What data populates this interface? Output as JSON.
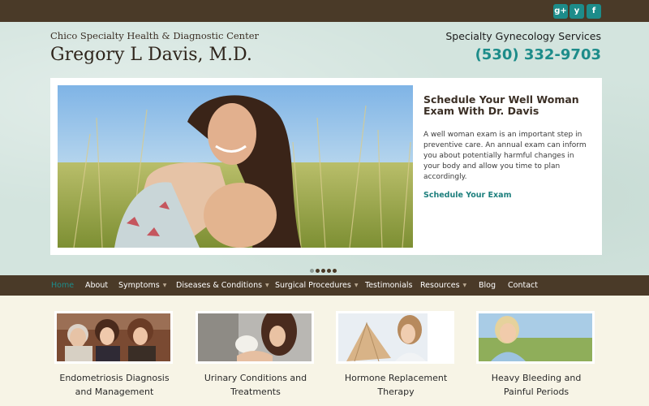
{
  "social": {
    "gplus": "g+",
    "yelp": "y",
    "facebook": "f"
  },
  "header": {
    "practice": "Chico Specialty Health & Diagnostic Center",
    "doctor": "Gregory L Davis, M.D.",
    "tagline": "Specialty Gynecology Services",
    "phone": "(530) 332-9703"
  },
  "slide": {
    "title_line1": "Schedule Your Well Woman",
    "title_line2": "Exam With Dr. Davis",
    "body": "A well woman exam is an important step in preventive care. An annual exam can inform you about potentially harmful changes in your body and allow you time to plan accordingly.",
    "link": "Schedule Your Exam"
  },
  "nav": {
    "home": "Home",
    "about": "About",
    "symptoms": "Symptoms",
    "diseases": "Diseases & Conditions",
    "surgical": "Surgical Procedures",
    "testimonials": "Testimonials",
    "resources": "Resources",
    "blog": "Blog",
    "contact": "Contact",
    "caret": "▼"
  },
  "cards": [
    {
      "line1": "Endometriosis Diagnosis",
      "line2": "and Management"
    },
    {
      "line1": "Urinary Conditions and",
      "line2": "Treatments"
    },
    {
      "line1": "Hormone Replacement",
      "line2": "Therapy"
    },
    {
      "line1": "Heavy Bleeding and",
      "line2": "Painful Periods"
    }
  ],
  "colors": {
    "brand": "#1d8c8a",
    "bar": "#4a3a28",
    "header_bg": "#d3e4de"
  }
}
